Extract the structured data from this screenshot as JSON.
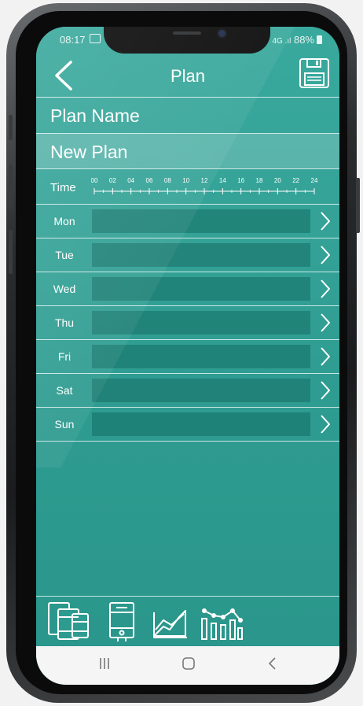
{
  "status_bar": {
    "time": "08:17",
    "signal": "4G .ıl",
    "battery": "88%"
  },
  "header": {
    "title": "Plan"
  },
  "plan_name": {
    "label": "Plan Name",
    "value": "New Plan"
  },
  "timeline": {
    "label": "Time",
    "ticks": [
      "00",
      "02",
      "04",
      "06",
      "08",
      "10",
      "12",
      "14",
      "16",
      "18",
      "20",
      "22",
      "24"
    ]
  },
  "days": [
    {
      "label": "Mon"
    },
    {
      "label": "Tue"
    },
    {
      "label": "Wed"
    },
    {
      "label": "Thu"
    },
    {
      "label": "Fri"
    },
    {
      "label": "Sat"
    },
    {
      "label": "Sun"
    }
  ],
  "bottom_nav": [
    "devices-icon",
    "boiler-icon",
    "area-chart-icon",
    "bar-line-chart-icon"
  ],
  "colors": {
    "app_bg": "#2f9d92",
    "accent_row": "rgba(255,255,255,0.18)",
    "day_bar": "#24857a",
    "text": "#ffffff"
  }
}
